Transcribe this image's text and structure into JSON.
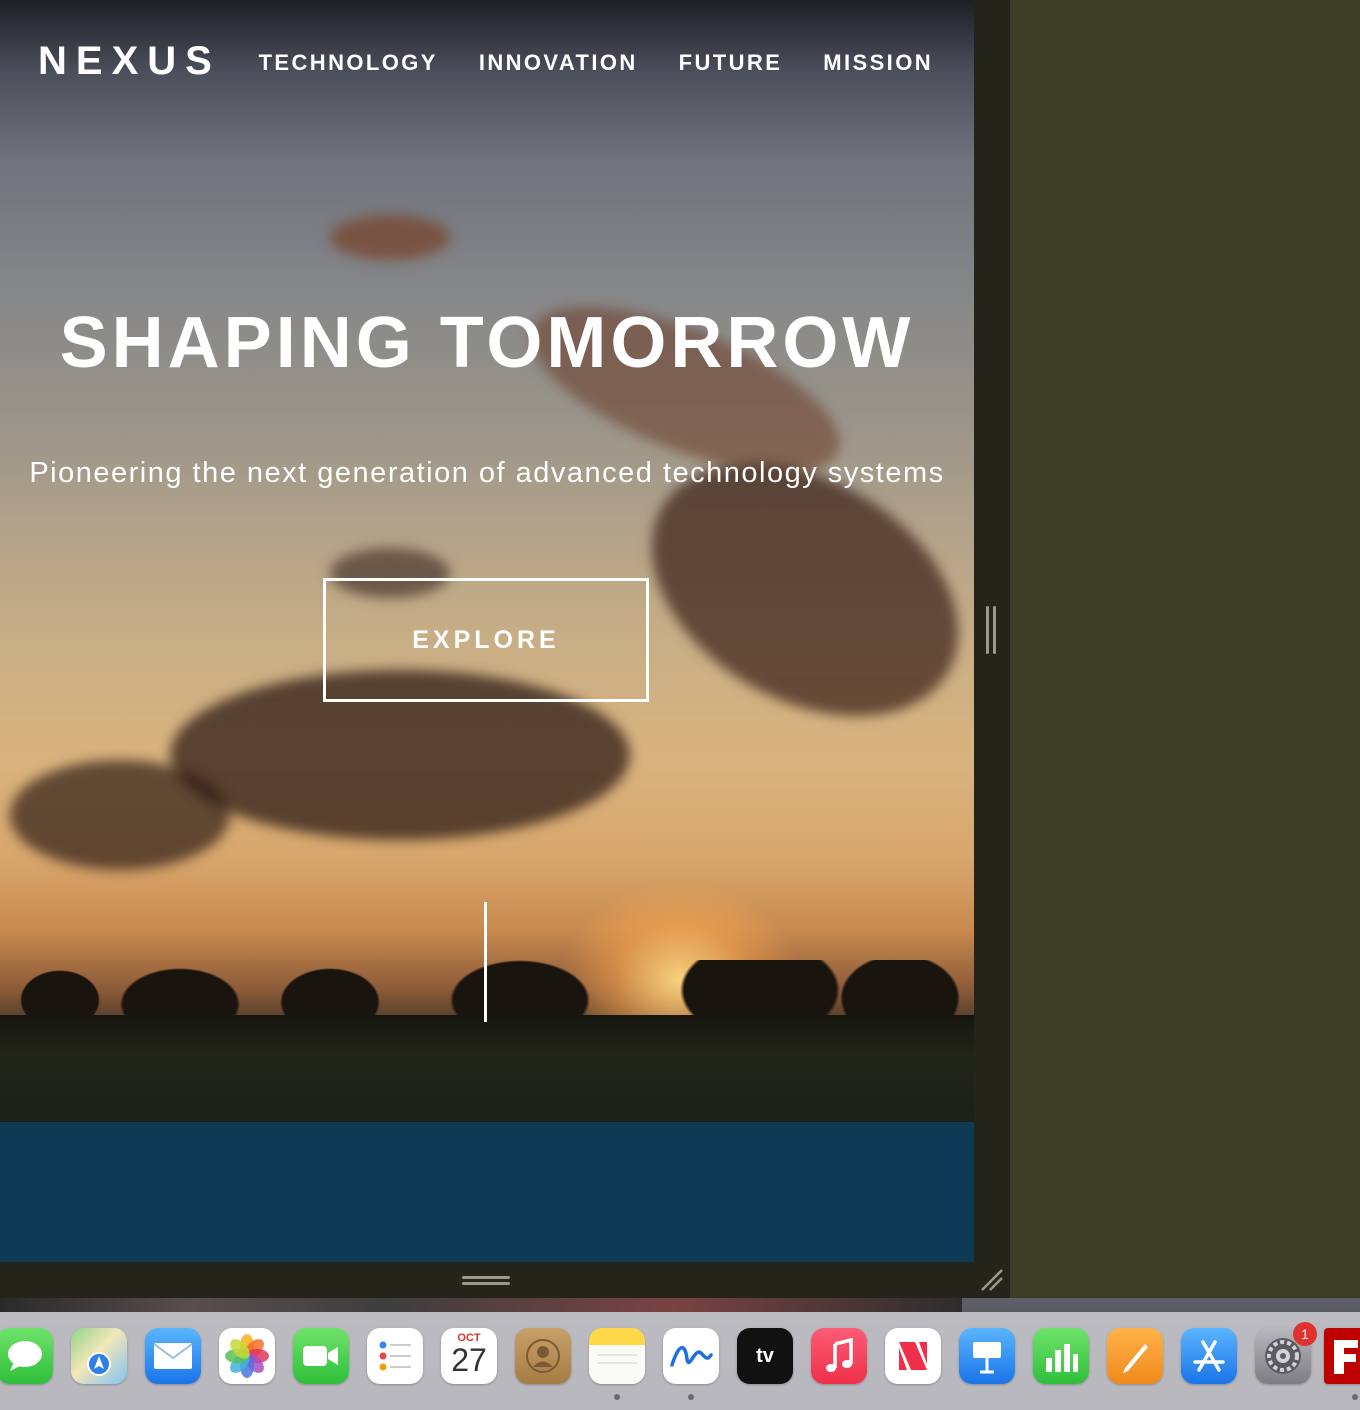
{
  "site": {
    "logo": "NEXUS",
    "nav": [
      "TECHNOLOGY",
      "INNOVATION",
      "FUTURE",
      "MISSION"
    ],
    "headline": "SHAPING TOMORROW",
    "subtitle": "Pioneering the next generation of advanced technology systems",
    "cta_label": "EXPLORE",
    "colors": {
      "accent_band": "#0f3a56",
      "text": "#ffffff"
    }
  },
  "dock": {
    "calendar": {
      "month": "OCT",
      "day": "27"
    },
    "apple_tv_label": "tv",
    "settings_badge": "1",
    "apps": [
      "messages-icon",
      "maps-icon",
      "mail-icon",
      "photos-icon",
      "facetime-icon",
      "reminders-icon",
      "calendar-icon",
      "contacts-icon",
      "notes-icon",
      "freeform-icon",
      "apple-tv-icon",
      "music-icon",
      "news-icon",
      "keynote-icon",
      "numbers-icon",
      "pages-icon",
      "app-store-icon",
      "system-settings-icon",
      "filezilla-icon"
    ]
  }
}
